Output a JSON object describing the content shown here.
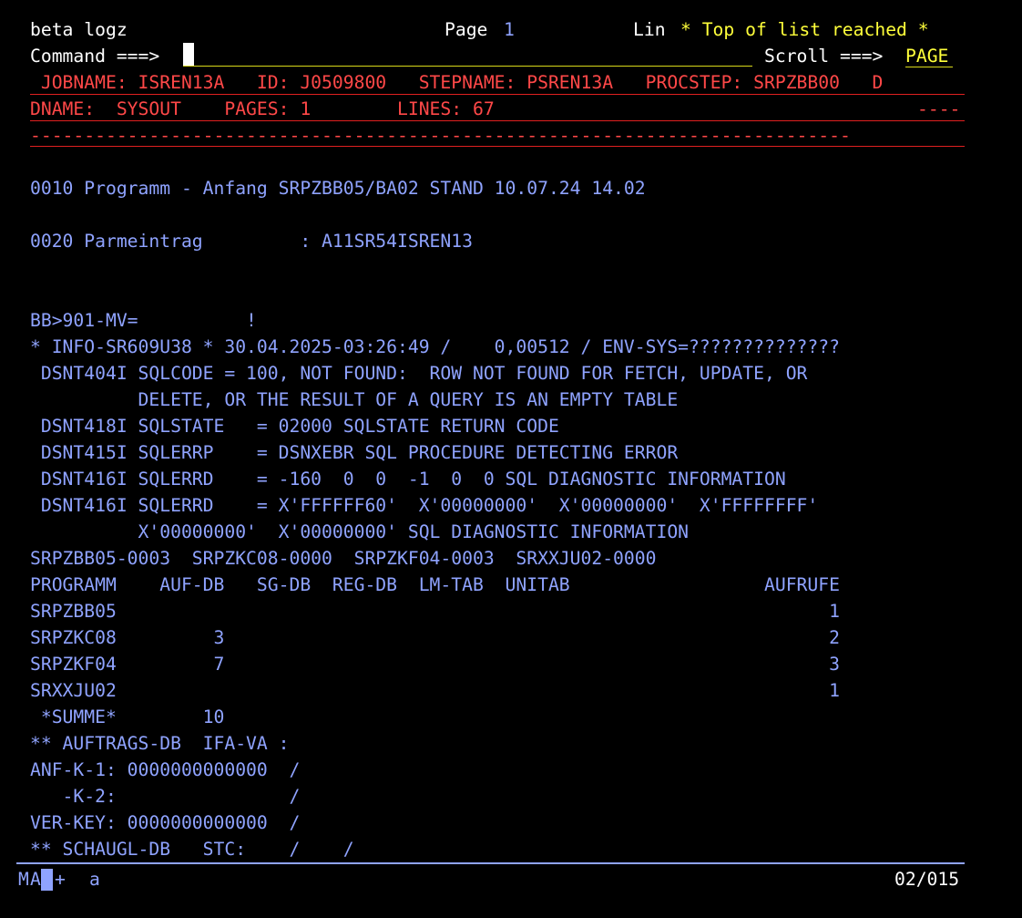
{
  "header": {
    "app_name": "beta logz",
    "page_label": "Page",
    "page_number": "1",
    "lin_label": "Lin",
    "top_message": "* Top of list reached *"
  },
  "command": {
    "label": "Command ===>",
    "value": "",
    "scroll_label": "Scroll ===>",
    "scroll_value": "PAGE"
  },
  "job_info": {
    "line1": " JOBNAME: ISREN13A   ID: J0509800   STEPNAME: PSREN13A   PROCSTEP: SRPZBB00   D",
    "line2": "DNAME:  SYSOUT    PAGES: 1        LINES: 67",
    "line2_right": "----",
    "separator": "----------------------------------------------------------------------------"
  },
  "output_lines": [
    "0010 Programm - Anfang SRPZBB05/BA02 STAND 10.07.24 14.02",
    "0020 Parmeintrag         : A11SR54ISREN13",
    "BB>901-MV=          !",
    "* INFO-SR609U38 * 30.04.2025-03:26:49 /    0,00512 / ENV-SYS=??????????????",
    " DSNT404I SQLCODE = 100, NOT FOUND:  ROW NOT FOUND FOR FETCH, UPDATE, OR",
    "          DELETE, OR THE RESULT OF A QUERY IS AN EMPTY TABLE",
    " DSNT418I SQLSTATE   = 02000 SQLSTATE RETURN CODE",
    " DSNT415I SQLERRP    = DSNXEBR SQL PROCEDURE DETECTING ERROR",
    " DSNT416I SQLERRD    = -160  0  0  -1  0  0 SQL DIAGNOSTIC INFORMATION",
    " DSNT416I SQLERRD    = X'FFFFFF60'  X'00000000'  X'00000000'  X'FFFFFFFF'",
    "          X'00000000'  X'00000000' SQL DIAGNOSTIC INFORMATION",
    "SRPZBB05-0003  SRPZKC08-0000  SRPZKF04-0003  SRXXJU02-0000",
    "PROGRAMM    AUF-DB   SG-DB  REG-DB  LM-TAB  UNITAB                  AUFRUFE",
    "SRPZBB05                                                                  1",
    "SRPZKC08         3                                                        2",
    "SRPZKF04         7                                                        3",
    "SRXXJU02                                                                  1",
    " *SUMME*        10",
    "** AUFTRAGS-DB  IFA-VA :",
    "ANF-K-1: 0000000000000  /",
    "   -K-2:                /",
    "VER-KEY: 0000000000000  /",
    "** SCHAUGL-DB   STC:    /    /"
  ],
  "status": {
    "left_a": "M",
    "left_b": "A",
    "plus": "+",
    "mode": "a",
    "position": "02/015"
  }
}
